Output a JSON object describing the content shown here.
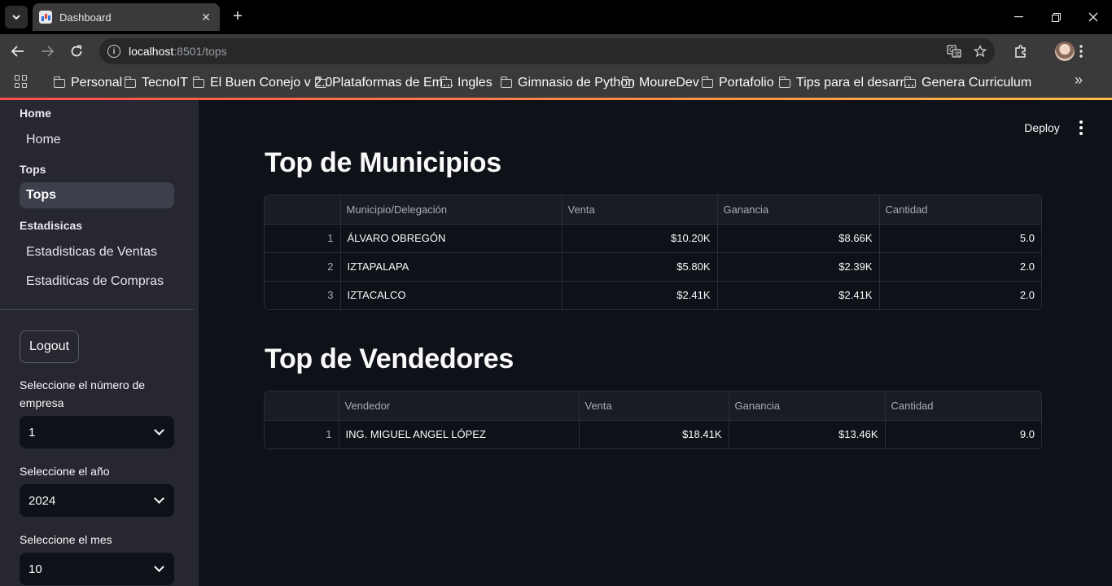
{
  "browser": {
    "tab_title": "Dashboard",
    "tab_close": "✕",
    "new_tab": "+",
    "url_host": "localhost",
    "url_rest": ":8501/tops",
    "bookmarks": [
      "Personal",
      "TecnoIT",
      "El Buen Conejo v 2.0",
      "Plataformas de Em...",
      "Ingles",
      "Gimnasio de Python",
      "MoureDev",
      "Portafolio",
      "Tips para el desarr...",
      "Genera Curriculum"
    ]
  },
  "sidebar": {
    "sections": [
      {
        "header": "Home",
        "items": [
          {
            "label": "Home",
            "active": false
          }
        ]
      },
      {
        "header": "Tops",
        "items": [
          {
            "label": "Tops",
            "active": true
          }
        ]
      },
      {
        "header": "Estadisicas",
        "items": [
          {
            "label": "Estadisticas de Ventas",
            "active": false
          },
          {
            "label": "Estaditicas de Compras",
            "active": false
          }
        ]
      }
    ],
    "logout_label": "Logout",
    "company_label": "Seleccione el número de empresa",
    "company_value": "1",
    "year_label": "Seleccione el año",
    "year_value": "2024",
    "month_label": "Seleccione el mes",
    "month_value": "10"
  },
  "header": {
    "deploy_label": "Deploy"
  },
  "municipios": {
    "title": "Top de Municipios",
    "columns": [
      "",
      "Municipio/Delegación",
      "Venta",
      "Ganancia",
      "Cantidad"
    ],
    "rows": [
      [
        "1",
        "ÁLVARO OBREGÓN",
        "$10.20K",
        "$8.66K",
        "5.0"
      ],
      [
        "2",
        "IZTAPALAPA",
        "$5.80K",
        "$2.39K",
        "2.0"
      ],
      [
        "3",
        "IZTACALCO",
        "$2.41K",
        "$2.41K",
        "2.0"
      ]
    ]
  },
  "vendedores": {
    "title": "Top de Vendedores",
    "columns": [
      "",
      "Vendedor",
      "Venta",
      "Ganancia",
      "Cantidad"
    ],
    "rows": [
      [
        "1",
        "ING. MIGUEL ANGEL LÓPEZ",
        "$18.41K",
        "$13.46K",
        "9.0"
      ]
    ]
  }
}
